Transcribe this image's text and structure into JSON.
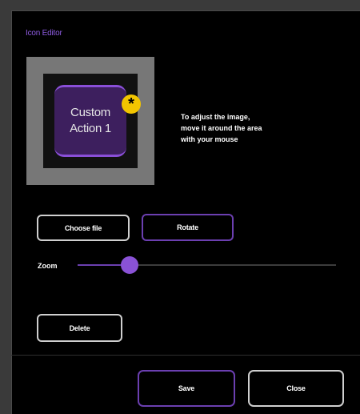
{
  "dialog": {
    "title": "Icon Editor"
  },
  "preview": {
    "tile_label": "Custom\nAction 1",
    "badge_symbol": "*",
    "badge_color": "#f2c500",
    "tile_color": "#3d1f5e",
    "accent_color": "#8a4fd8"
  },
  "hint": {
    "text": "To adjust the image,\nmove it around the area\nwith your mouse"
  },
  "buttons": {
    "choose_file": "Choose file",
    "rotate": "Rotate",
    "delete": "Delete",
    "save": "Save",
    "close": "Close"
  },
  "zoom": {
    "label": "Zoom",
    "value_fraction": 0.2
  },
  "colors": {
    "title": "#8d5be0",
    "background": "#000000",
    "slider": "#8a52d6"
  }
}
